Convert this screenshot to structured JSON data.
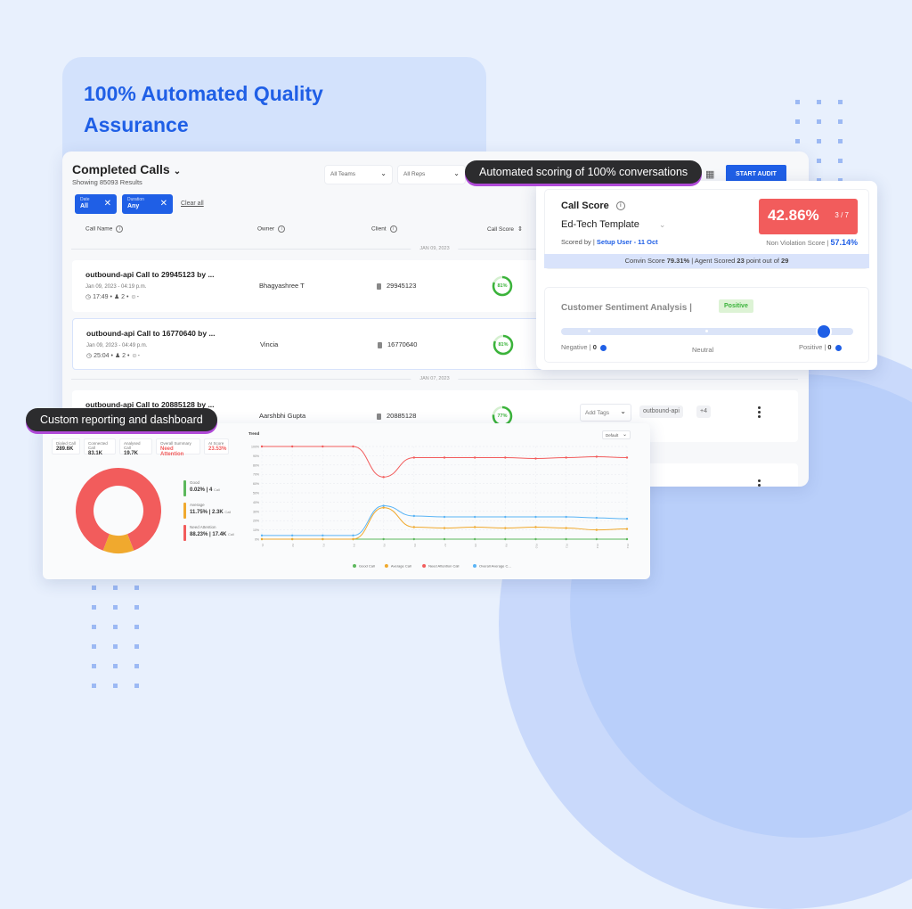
{
  "hero": {
    "title": "100% Automated Quality Assurance"
  },
  "callouts": {
    "scoring": "Automated scoring of 100% conversations",
    "reporting": "Custom reporting and dashboard"
  },
  "calls": {
    "title": "Completed Calls",
    "subtitle": "Showing 85093 Results",
    "filters": {
      "teams": "All Teams",
      "reps": "All Reps"
    },
    "chips": [
      {
        "label": "Date",
        "value": "All"
      },
      {
        "label": "Duration",
        "value": "Any"
      }
    ],
    "clear_all": "Clear all",
    "start_audit": "START AUDIT",
    "columns": {
      "call_name": "Call Name",
      "owner": "Owner",
      "client": "Client",
      "call_score": "Call Score"
    },
    "groups": [
      {
        "date": "JAN 09, 2023"
      },
      {
        "date": "JAN 07, 2023"
      }
    ],
    "rows": [
      {
        "name": "outbound-api Call to 29945123 by ...",
        "datetime": "Jan 09, 2023 - 04:19 p.m.",
        "duration": "17:49",
        "participants": "2",
        "comments": "-",
        "owner": "Bhagyashree T",
        "client": "29945123",
        "score": "81%",
        "score_value": 0.81
      },
      {
        "name": "outbound-api Call to 16770640 by ...",
        "datetime": "Jan 09, 2023 - 04:49 p.m.",
        "duration": "25:04",
        "participants": "2",
        "comments": "-",
        "owner": "Vincia",
        "client": "16770640",
        "score": "81%",
        "score_value": 0.81
      },
      {
        "name": "outbound-api Call to 20885128 by ...",
        "owner": "Aarshbhi Gupta",
        "client": "20885128",
        "score": "77%",
        "score_value": 0.77,
        "add_tags": "Add Tags",
        "tag": "outbound-api",
        "more_tags": "+4"
      }
    ]
  },
  "call_score": {
    "title": "Call Score",
    "template": "Ed-Tech Template",
    "scored_by_label": "Scored by |",
    "scored_by": "Setup User - 11 Oct",
    "score": "42.86%",
    "fraction": "3 / 7",
    "non_violation_label": "Non Violation Score |",
    "non_violation": "57.14%",
    "summary_parts": [
      "Convin Score ",
      "79.31%",
      " | Agent Scored ",
      "23",
      " point out of ",
      "29"
    ]
  },
  "sentiment": {
    "title": "Customer Sentiment Analysis |",
    "badge": "Positive",
    "negative_label": "Negative |",
    "negative_count": "0",
    "neutral_label": "Neutral",
    "positive_label": "Positive |",
    "positive_count": "0",
    "level": 0.9
  },
  "dashboard": {
    "kpis": [
      {
        "label": "Dialed Call",
        "value": "289.6K"
      },
      {
        "label": "Connected Call",
        "value": "83.1K"
      },
      {
        "label": "Analysed Call",
        "value": "19.7K"
      },
      {
        "label": "Overall Summary",
        "value": "Need Attention",
        "alert": true
      },
      {
        "label": "AI Score",
        "value": "23.53%",
        "alert": true
      }
    ],
    "breakdown": [
      {
        "label": "Good",
        "value": "0.02% | 4",
        "unit": "Call",
        "color": "#5cb85c"
      },
      {
        "label": "Average",
        "value": "11.75% | 2.3K",
        "unit": "Call",
        "color": "#f0a92e"
      },
      {
        "label": "Need Attention",
        "value": "88.23% | 17.4K",
        "unit": "Call",
        "color": "#f25c5c"
      }
    ],
    "trend_title": "Trend",
    "default_select": "Default"
  },
  "chart_data": [
    {
      "type": "pie",
      "title": "",
      "labels": [
        "Good",
        "Average",
        "Need Attention"
      ],
      "values": [
        0.02,
        11.75,
        88.23
      ],
      "colors": [
        "#5cb85c",
        "#f0a92e",
        "#f25c5c"
      ],
      "donut": true
    },
    {
      "type": "line",
      "title": "Trend",
      "xlabel": "",
      "ylabel": "",
      "ylim": [
        0,
        100
      ],
      "yticks": [
        "0%",
        "10%",
        "20%",
        "30%",
        "40%",
        "50%",
        "60%",
        "70%",
        "80%",
        "90%",
        "100%"
      ],
      "x": [
        "P1",
        "P2",
        "P3",
        "P4",
        "P5",
        "P6",
        "P7",
        "P8",
        "P9",
        "P10",
        "P11",
        "P12",
        "P13"
      ],
      "grid": true,
      "legend": "bottom",
      "series": [
        {
          "name": "Good Call",
          "color": "#5cb85c",
          "values": [
            0,
            0,
            0,
            0,
            0,
            0,
            0,
            0,
            0,
            0,
            0,
            0,
            0
          ]
        },
        {
          "name": "Average Call",
          "color": "#f0a92e",
          "values": [
            0,
            0,
            0,
            0,
            34,
            13,
            12,
            13,
            12,
            13,
            12,
            10,
            11
          ]
        },
        {
          "name": "Need Attention Call",
          "color": "#f25c5c",
          "values": [
            100,
            100,
            100,
            100,
            67,
            88,
            88,
            88,
            88,
            87,
            88,
            89,
            88
          ]
        },
        {
          "name": "Overall Average C...",
          "color": "#5ab4f5",
          "values": [
            4,
            4,
            4,
            4,
            36,
            25,
            24,
            24,
            24,
            24,
            24,
            23,
            22
          ]
        }
      ]
    }
  ],
  "colors": {
    "brand": "#1f5fe6",
    "alert": "#f25c5c",
    "positive": "#3bb33b"
  }
}
